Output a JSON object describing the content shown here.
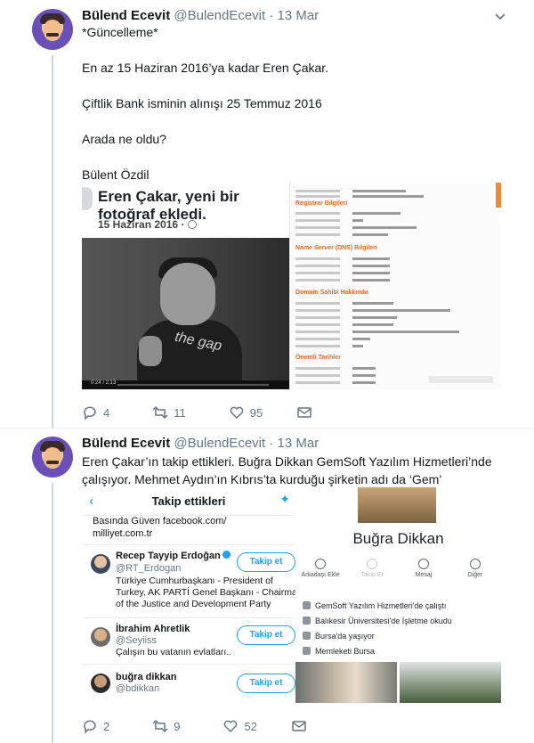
{
  "tweets": [
    {
      "name": "Bülend Ecevit",
      "handle": "@BulendEcevit",
      "separator": "·",
      "date": "13 Mar",
      "lines": [
        "*Güncelleme*",
        "En az 15 Haziran 2016’ya kadar Eren Çakar.",
        "Çiftlik Bank isminin alınışı 25 Temmuz 2016",
        "Arada ne oldu?",
        "Bülent Özdil"
      ],
      "replies": "4",
      "retweets": "11",
      "likes": "95"
    },
    {
      "name": "Bülend Ecevit",
      "handle": "@BulendEcevit",
      "separator": "·",
      "date": "13 Mar",
      "lines": [
        "Eren Çakar’ın takip ettikleri. Buğra Dikkan GemSoft Yazılım Hizmetleri’nde",
        "çalışıyor. Mehmet Aydın’ın Kıbrıs’ta kurduğu şirketin adı da ‘Gem’"
      ],
      "replies": "2",
      "retweets": "9",
      "likes": "52"
    }
  ],
  "media1": {
    "fb_title": "Eren Çakar, yeni bir fotoğraf ekledi.",
    "fb_date": "15 Haziran 2016 ·",
    "video_time": "0:24 / 2:13",
    "gap_logo": "the gap",
    "whois_sections": [
      "Registrar Bilgileri",
      "Name Server (DNS) Bilgileri",
      "Domain Sahibi Hakkında",
      "Önemli Tarihler"
    ]
  },
  "media2": {
    "twitter_title": "Takip ettikleri",
    "prev_bio_line1": "Basında Güven facebook.com/",
    "prev_bio_line2": "milliyet.com.tr",
    "follow_label": "Takip et",
    "following": [
      {
        "name": "Recep Tayyip Erdoğan",
        "handle": "@RT_Erdogan",
        "bio": "Türkiye Cumhurbaşkanı - President of Turkey, AK PARTİ Genel Başkanı - Chairman of the Justice and Development Party",
        "verified": true
      },
      {
        "name": "İbrahim Ahretlik",
        "handle": "@Seyiiss",
        "bio": "Çalışın bu vatanın evlatları..",
        "verified": false
      },
      {
        "name": "buğra dikkan",
        "handle": "@bdikkan",
        "bio": "",
        "verified": false
      }
    ],
    "profile_name": "Buğra Dikkan",
    "profile_actions": [
      "Arkadaşı Ekle",
      "Takip Et",
      "Mesaj",
      "Diğer"
    ],
    "profile_info": [
      {
        "text": "GemSoft Yazılım Hizmetleri'de çalıştı"
      },
      {
        "text": "Balıkesir Üniversitesi'de İşletme okudu"
      },
      {
        "text": "Bursa'da yaşıyor"
      },
      {
        "text": "Memleketi Bursa"
      }
    ]
  }
}
